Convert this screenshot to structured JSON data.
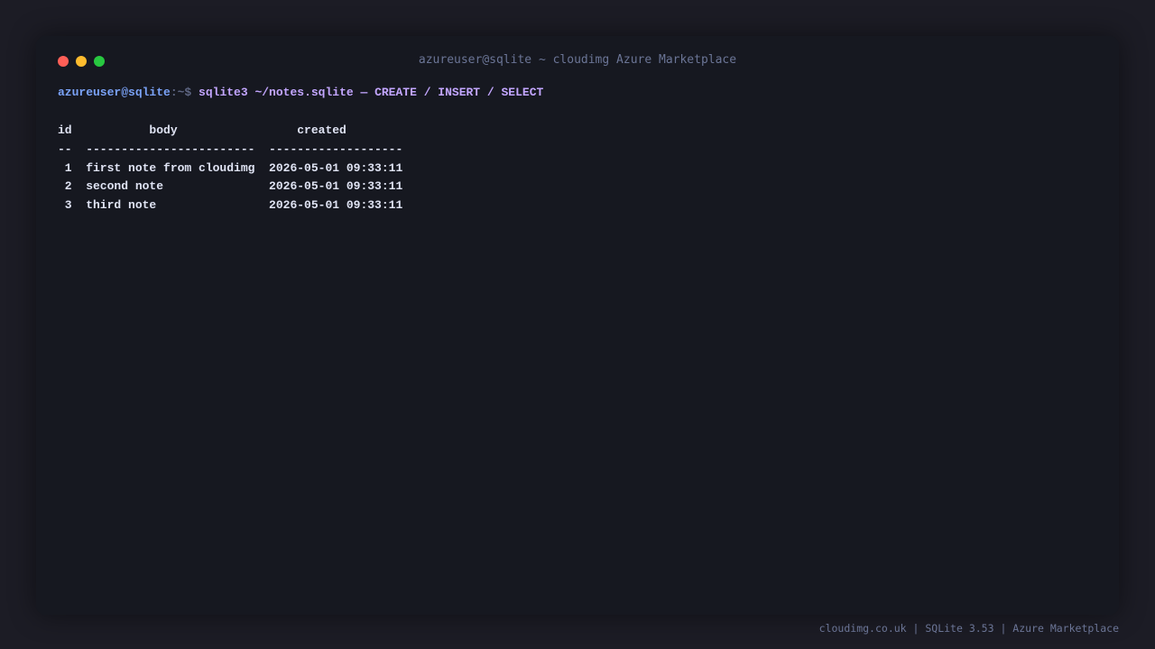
{
  "window": {
    "title": "azureuser@sqlite ~ cloudimg Azure Marketplace"
  },
  "terminal": {
    "prompt_user": "azureuser@sqlite",
    "prompt_sep": ":~$ ",
    "command": "sqlite3 ~/notes.sqlite — CREATE / INSERT / SELECT",
    "table": {
      "header": "id           body                 created",
      "divider": "--  ------------------------  -------------------",
      "rows": [
        " 1  first note from cloudimg  2026-05-01 09:33:11",
        " 2  second note               2026-05-01 09:33:11",
        " 3  third note                2026-05-01 09:33:11"
      ]
    }
  },
  "footer": {
    "text": "cloudimg.co.uk | SQLite 3.53 | Azure Marketplace"
  },
  "colors": {
    "background": "#1c1c25",
    "window": "#161820",
    "prompt_user": "#7aa2f7",
    "command": "#c3a6ff",
    "output": "#dfe3f3"
  }
}
